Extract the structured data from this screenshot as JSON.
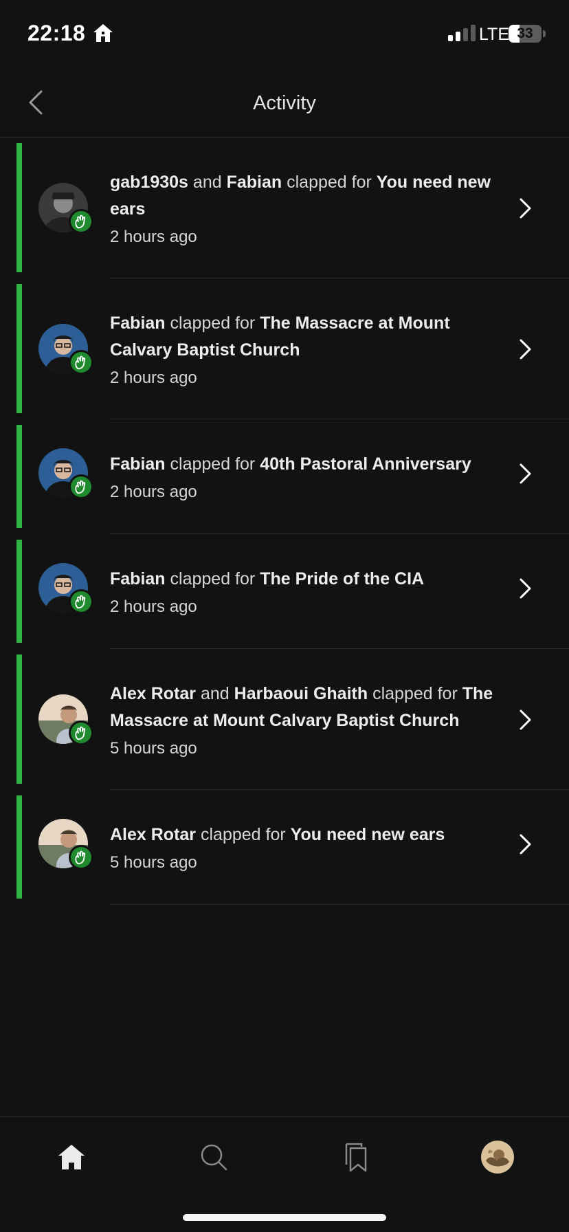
{
  "status_bar": {
    "time": "22:18",
    "network": "LTE",
    "battery": "33",
    "signal_bars_active": 2,
    "signal_bars_total": 4
  },
  "header": {
    "title": "Activity",
    "back_icon": "chevron-left-icon"
  },
  "activity": [
    {
      "actors": [
        "gab1930s",
        "Fabian"
      ],
      "joiner": "and",
      "action": "clapped for",
      "story": "You need new ears",
      "time": "2 hours ago",
      "avatar": "vintage-portrait",
      "badge_icon": "clap-icon"
    },
    {
      "actors": [
        "Fabian"
      ],
      "joiner": "",
      "action": "clapped for",
      "story": "The Massacre at Mount Calvary Baptist Church",
      "time": "2 hours ago",
      "avatar": "fabian-portrait",
      "badge_icon": "clap-icon"
    },
    {
      "actors": [
        "Fabian"
      ],
      "joiner": "",
      "action": "clapped for",
      "story": "40th Pastoral Anniversary",
      "time": "2 hours ago",
      "avatar": "fabian-portrait",
      "badge_icon": "clap-icon"
    },
    {
      "actors": [
        "Fabian"
      ],
      "joiner": "",
      "action": "clapped for",
      "story": "The Pride of the CIA",
      "time": "2 hours ago",
      "avatar": "fabian-portrait",
      "badge_icon": "clap-icon"
    },
    {
      "actors": [
        "Alex Rotar",
        "Harbaoui Ghaith"
      ],
      "joiner": "and",
      "action": "clapped for",
      "story": "The Massacre at Mount Calvary Baptist Church",
      "time": "5 hours ago",
      "avatar": "alex-portrait",
      "badge_icon": "clap-icon"
    },
    {
      "actors": [
        "Alex Rotar"
      ],
      "joiner": "",
      "action": "clapped for",
      "story": "You need new ears",
      "time": "5 hours ago",
      "avatar": "alex-portrait",
      "badge_icon": "clap-icon"
    }
  ],
  "bottom_nav": [
    {
      "icon": "home-icon",
      "active": true
    },
    {
      "icon": "search-icon",
      "active": false
    },
    {
      "icon": "bookmarks-icon",
      "active": false
    },
    {
      "icon": "profile-avatar",
      "active": false
    }
  ],
  "colors": {
    "background": "#121212",
    "unread_accent": "#2fb344",
    "clap_badge": "#1f8a2e",
    "divider": "#2e2e2e",
    "text": "#d6d6d6"
  }
}
